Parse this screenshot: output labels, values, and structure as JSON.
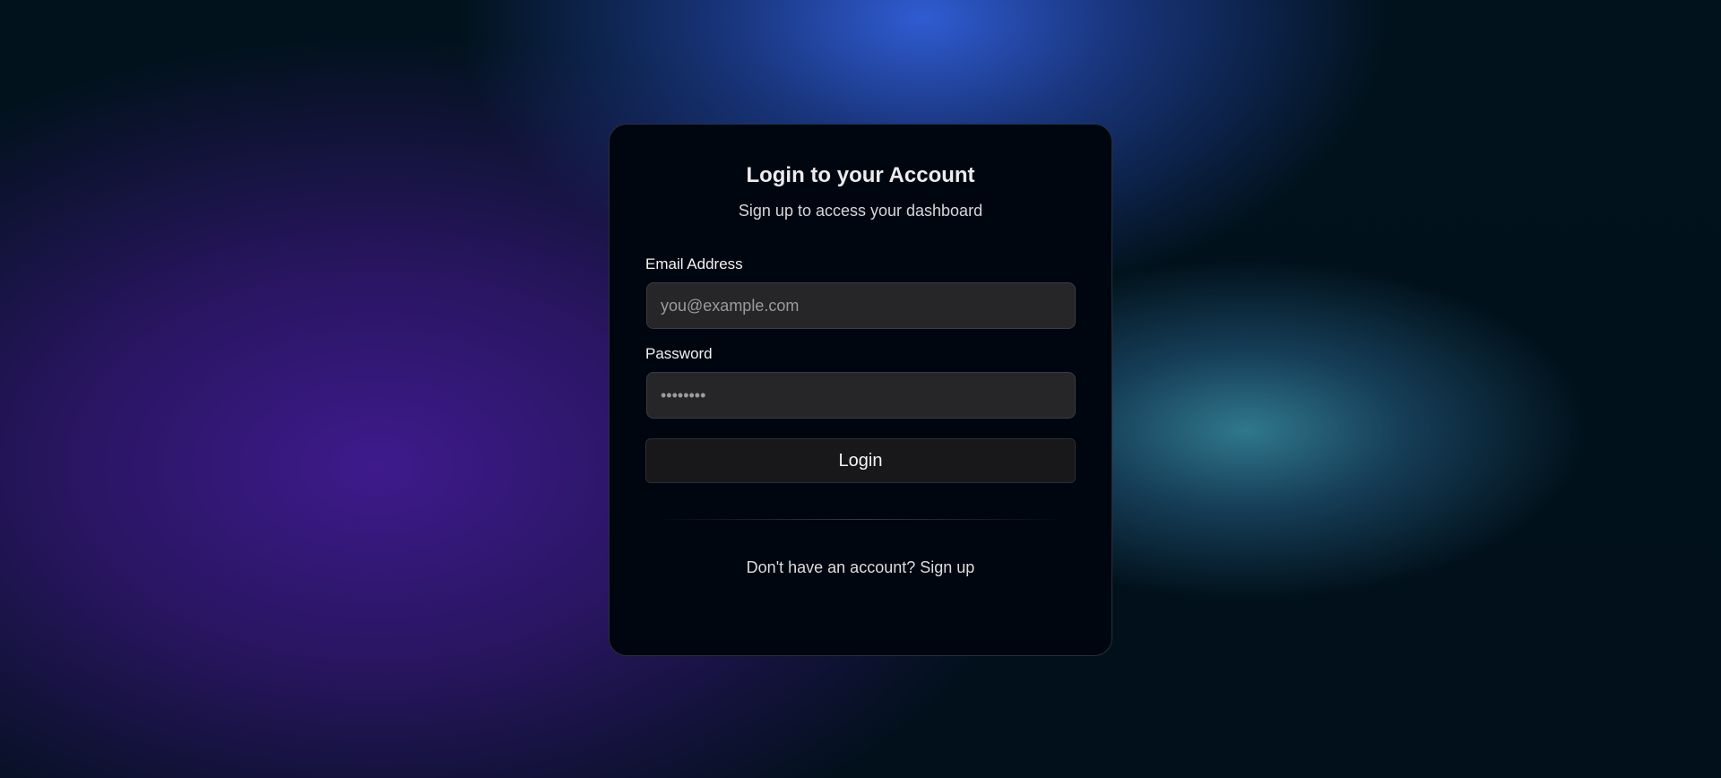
{
  "login": {
    "title": "Login to your Account",
    "subtitle": "Sign up to access your dashboard",
    "email": {
      "label": "Email Address",
      "placeholder": "you@example.com",
      "value": ""
    },
    "password": {
      "label": "Password",
      "value": "••••••••"
    },
    "submit_label": "Login",
    "footer": {
      "prompt": "Don't have an account?",
      "link_label": "Sign up"
    }
  },
  "colors": {
    "card_background": "#00060f",
    "input_background": "#262628",
    "button_background": "#18181b",
    "glow_blue": "#305cd2",
    "glow_purple": "#3e1a8c",
    "glow_teal": "#388aa0"
  }
}
